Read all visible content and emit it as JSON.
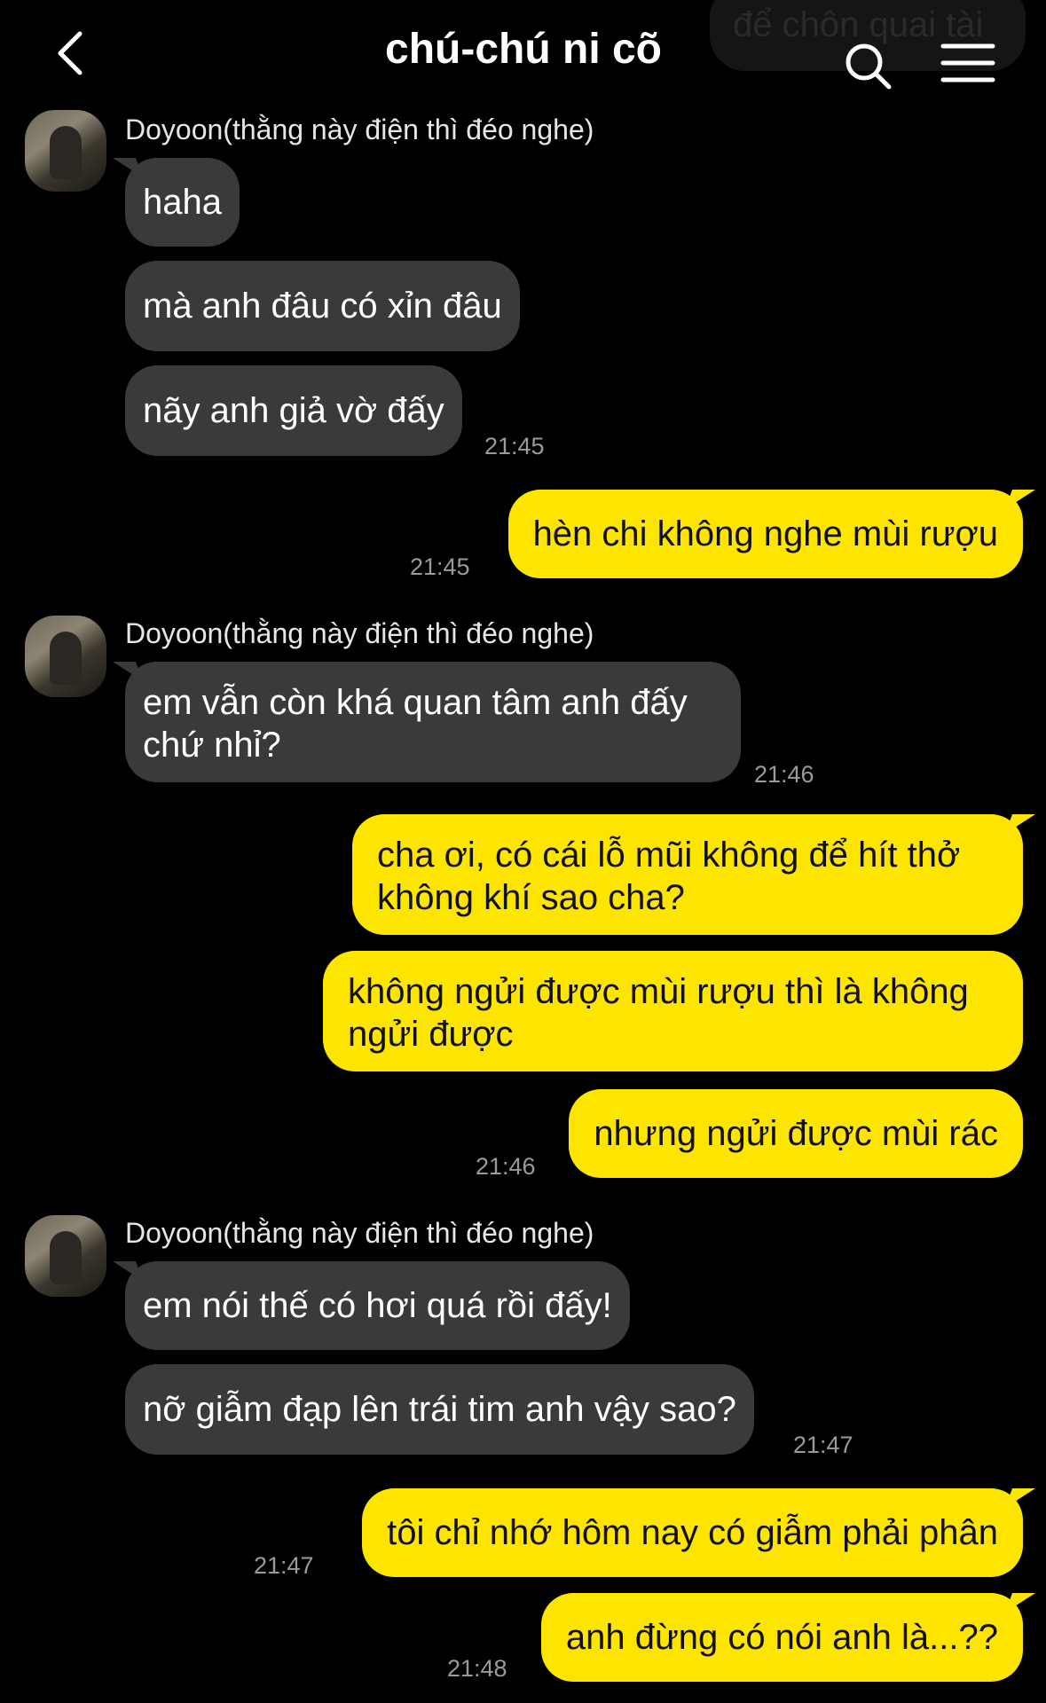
{
  "header": {
    "title": "chú-chú ni cõ",
    "ghost_text": "để chôn quai tài"
  },
  "colors": {
    "background": "#000000",
    "incoming_bubble": "#3a3a3c",
    "outgoing_bubble": "#fee500"
  },
  "messages": {
    "g1_sender": "Doyoon(thằng này điện thì đéo nghe)",
    "m1": "haha",
    "m2": "mà anh đâu có xỉn đâu",
    "m3": "nãy anh giả vờ đấy",
    "t1": "21:45",
    "m4": "hèn chi không nghe mùi rượu",
    "t2": "21:45",
    "g2_sender": "Doyoon(thằng này điện thì đéo nghe)",
    "m5_line1": "em vẫn còn khá quan tâm anh đấy",
    "m5_line2": "chứ nhỉ?",
    "t3": "21:46",
    "m6_line1": "cha ơi, có cái lỗ mũi không để hít thở",
    "m6_line2": "không khí sao cha?",
    "m7_line1": "không ngửi được mùi rượu thì là không",
    "m7_line2": "ngửi được",
    "m8": "nhưng ngửi được mùi rác",
    "t4": "21:46",
    "g3_sender": "Doyoon(thằng này điện thì đéo nghe)",
    "m9": "em nói thế có hơi quá rồi đấy!",
    "m10": "nỡ giẫm đạp lên trái tim anh vậy sao?",
    "t5": "21:47",
    "m11": "tôi chỉ nhớ hôm nay có giẫm phải phân",
    "t6": "21:47",
    "m12": "anh đừng có nói anh là...??",
    "t7": "21:48"
  }
}
